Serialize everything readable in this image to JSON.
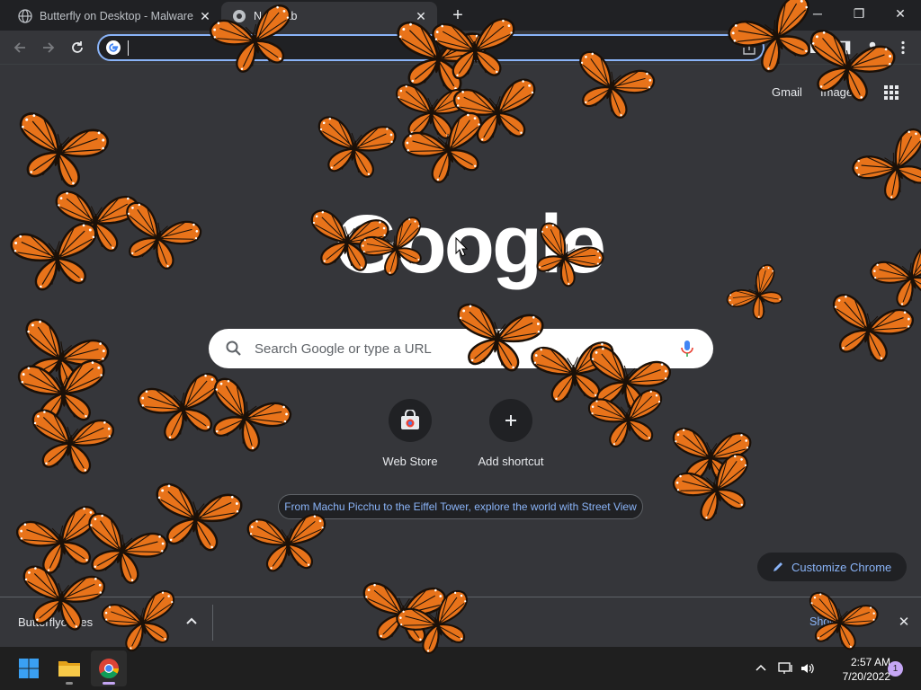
{
  "browser": {
    "tabs": [
      {
        "title": "Butterfly on Desktop - Malware W",
        "active": false
      },
      {
        "title": "New Tab",
        "active": true
      }
    ],
    "address": {
      "value": ""
    },
    "accent": "#8ab4f8"
  },
  "ntp": {
    "top_links": {
      "gmail": "Gmail",
      "images": "Images"
    },
    "logo_text": "Google",
    "search_placeholder": "Search Google or type a URL",
    "shortcuts": [
      {
        "label": "Web Store",
        "icon": "web-store-icon"
      },
      {
        "label": "Add shortcut",
        "icon": "plus-icon"
      }
    ],
    "promo_text": "From Machu Picchu to the Eiffel Tower, explore the world with Street View",
    "customize_label": "Customize Chrome"
  },
  "download_bar": {
    "file_name": "Butterflyondes",
    "show_all": "Show all"
  },
  "taskbar": {
    "time": "2:57 AM",
    "date": "7/20/2022",
    "notification_count": "1"
  },
  "overlay": {
    "butterfly_colors": {
      "wing": "#e8731a",
      "vein": "#1a1008",
      "spot": "#ffffff"
    }
  }
}
